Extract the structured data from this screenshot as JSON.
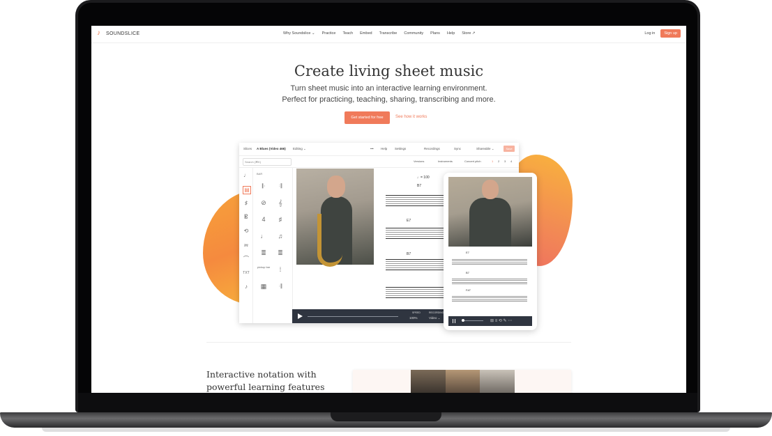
{
  "brand": {
    "name": "SOUNDSLICE"
  },
  "nav": {
    "links": [
      "Why Soundslice ⌄",
      "Practice",
      "Teach",
      "Embed",
      "Transcribe",
      "Community",
      "Plans",
      "Help",
      "Store ↗"
    ],
    "login": "Log in",
    "signup": "Sign up"
  },
  "hero": {
    "title": "Create living sheet music",
    "subtitle_1": "Turn sheet music into an interactive learning environment.",
    "subtitle_2": "Perfect for practicing, teaching, sharing, transcribing and more.",
    "cta_primary": "Get started for free",
    "cta_secondary": "See how it works"
  },
  "editor": {
    "breadcrumb": "Slices",
    "slice_title": "A Blues (Video 466)",
    "mode": "Editing ⌄",
    "top_items": [
      "•••",
      "Help",
      "Settings",
      "Recordings",
      "Sync",
      "Shareable ⌄",
      "Save"
    ],
    "search_placeholder": "Search (⌘K)",
    "tool_items": [
      "Versions",
      "Instruments",
      "Concert pitch"
    ],
    "pages": [
      "1",
      "2",
      "3",
      "4"
    ],
    "palette_header": "BAR",
    "palette_text_item": "TXT",
    "palette_pickup": "pickup bar",
    "chords": [
      "B7",
      "E7",
      "B7"
    ],
    "tempo": "♩= 100",
    "player": {
      "speed_label": "SPEED",
      "speed": "100%",
      "recording_label": "RECORDING",
      "recording": "Video ⌄"
    }
  },
  "phone": {
    "chords": [
      "E7",
      "B7",
      "F#7"
    ]
  },
  "section": {
    "title": "Interactive notation with powerful learning features"
  },
  "colors": {
    "accent": "#f07a5a",
    "player_bg": "#2f3540"
  }
}
